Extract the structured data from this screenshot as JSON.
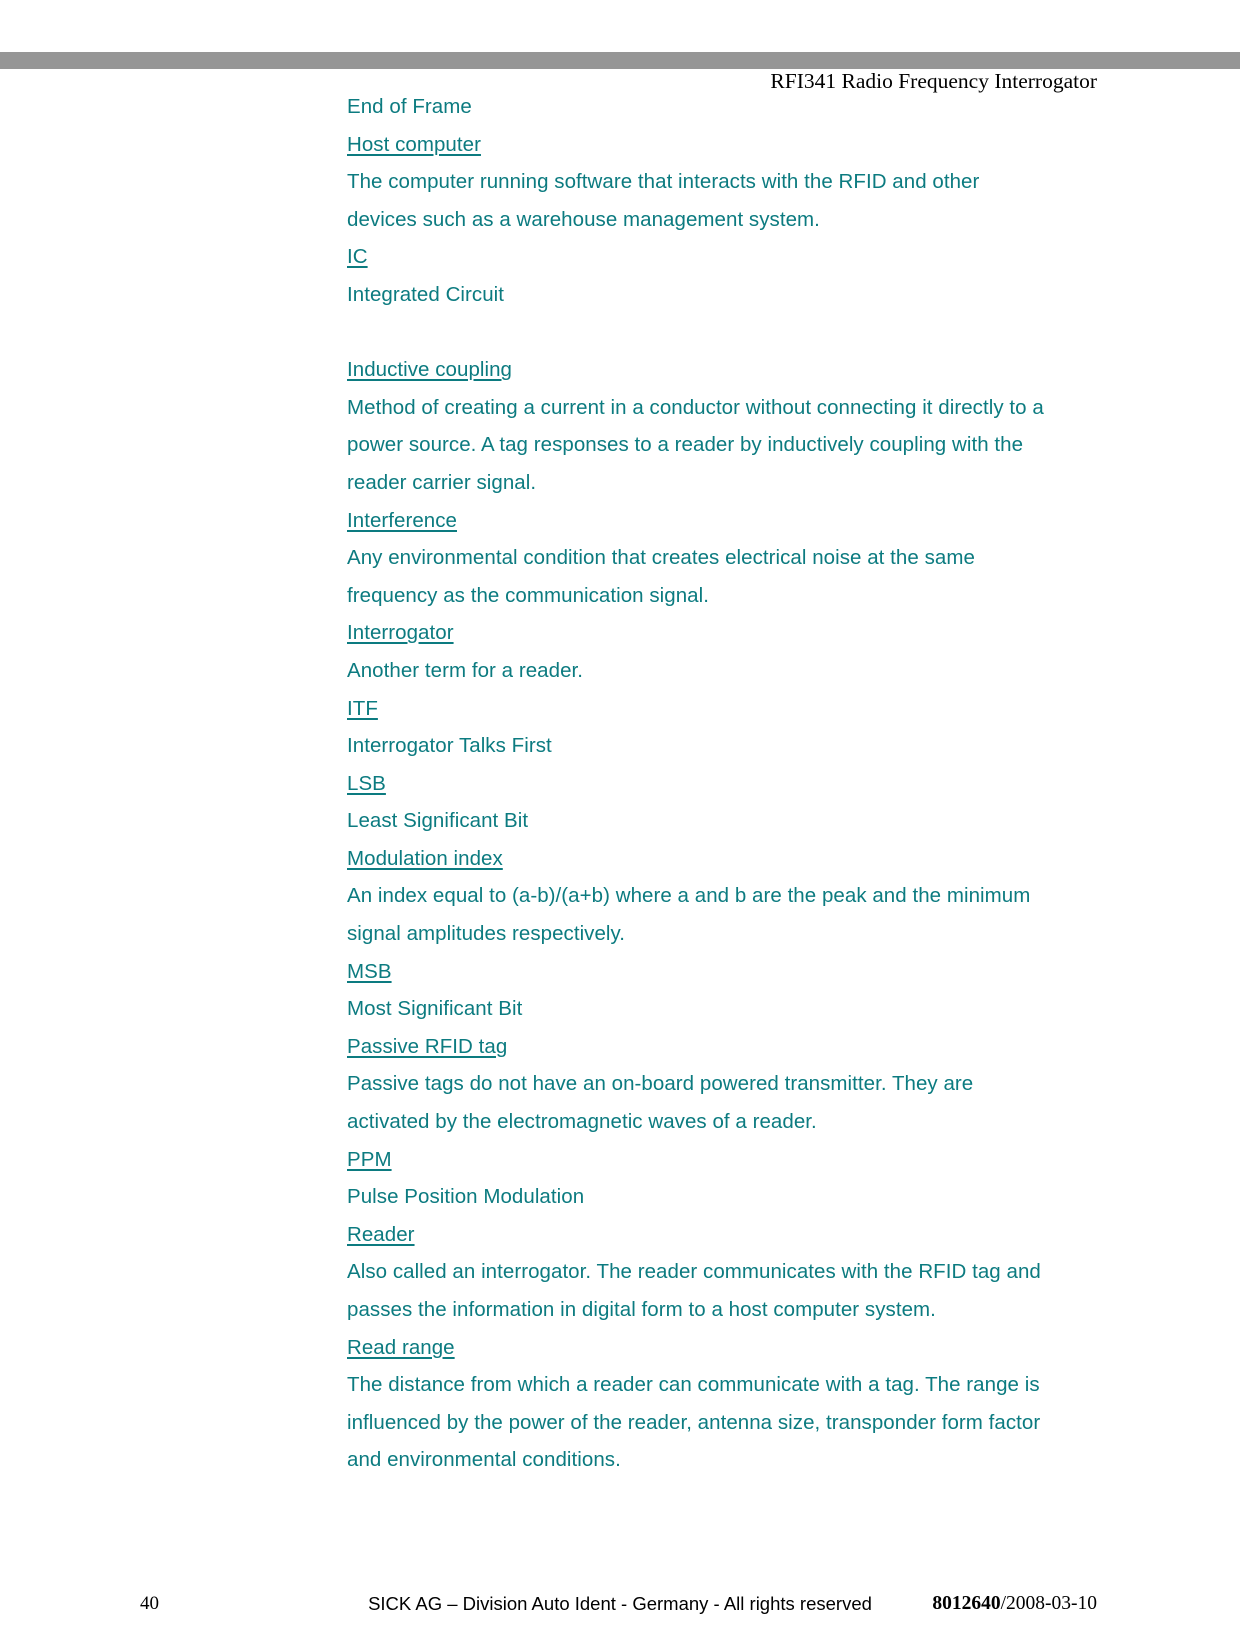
{
  "page": {
    "header": {
      "title": "RFI341 Radio Frequency Interrogator",
      "rule_color": "#969696"
    },
    "text_color": "#0C7B80",
    "body_lines": [
      {
        "text": "End of Frame",
        "style": "definition"
      },
      {
        "text": "Host computer",
        "style": "term"
      },
      {
        "text": "The computer running software that interacts with the RFID and other",
        "style": "definition"
      },
      {
        "text": "devices such as a warehouse management system.",
        "style": "definition"
      },
      {
        "text": "IC",
        "style": "term"
      },
      {
        "text": "Integrated Circuit",
        "style": "definition"
      },
      {
        "text": "",
        "style": "spacer"
      },
      {
        "text": "Inductive coupling",
        "style": "term"
      },
      {
        "text": "Method of creating a current in a conductor without connecting it directly to a",
        "style": "definition"
      },
      {
        "text": "power source. A tag responses to a reader by inductively coupling with the",
        "style": "definition"
      },
      {
        "text": "reader carrier signal.",
        "style": "definition"
      },
      {
        "text": "Interference",
        "style": "term"
      },
      {
        "text": "Any environmental condition that creates electrical noise at the same",
        "style": "definition"
      },
      {
        "text": "frequency as the communication signal.",
        "style": "definition"
      },
      {
        "text": "Interrogator",
        "style": "term"
      },
      {
        "text": "Another term for a reader.",
        "style": "definition"
      },
      {
        "text": "ITF",
        "style": "term"
      },
      {
        "text": "Interrogator Talks First",
        "style": "definition"
      },
      {
        "text": "LSB",
        "style": "term"
      },
      {
        "text": "Least Significant Bit",
        "style": "definition"
      },
      {
        "text": "Modulation index",
        "style": "term"
      },
      {
        "text": "An index equal to (a-b)/(a+b) where a and b are the peak and the minimum",
        "style": "definition"
      },
      {
        "text": "signal amplitudes respectively.",
        "style": "definition"
      },
      {
        "text": "MSB",
        "style": "term"
      },
      {
        "text": "Most Significant Bit",
        "style": "definition"
      },
      {
        "text": "Passive RFID tag",
        "style": "term"
      },
      {
        "text": "Passive tags do not have an on-board powered transmitter. They are",
        "style": "definition"
      },
      {
        "text": "activated by the electromagnetic waves of a reader.",
        "style": "definition"
      },
      {
        "text": "PPM",
        "style": "term"
      },
      {
        "text": "Pulse Position Modulation",
        "style": "definition"
      },
      {
        "text": "Reader",
        "style": "term"
      },
      {
        "text": "Also called an interrogator. The reader communicates with the RFID tag and",
        "style": "definition"
      },
      {
        "text": "passes the information in digital form to a host computer system.",
        "style": "definition"
      },
      {
        "text": "Read range",
        "style": "term"
      },
      {
        "text": "The distance from which a reader can communicate with a tag. The range is",
        "style": "definition"
      },
      {
        "text": "influenced by the power of the reader, antenna size, transponder form factor",
        "style": "definition"
      },
      {
        "text": "and environmental conditions.",
        "style": "definition"
      }
    ],
    "footer": {
      "page_number": "40",
      "copyright": "SICK AG – Division Auto Ident - Germany - All rights reserved",
      "doc_number": "8012640",
      "doc_date": "/2008-03-10"
    }
  }
}
